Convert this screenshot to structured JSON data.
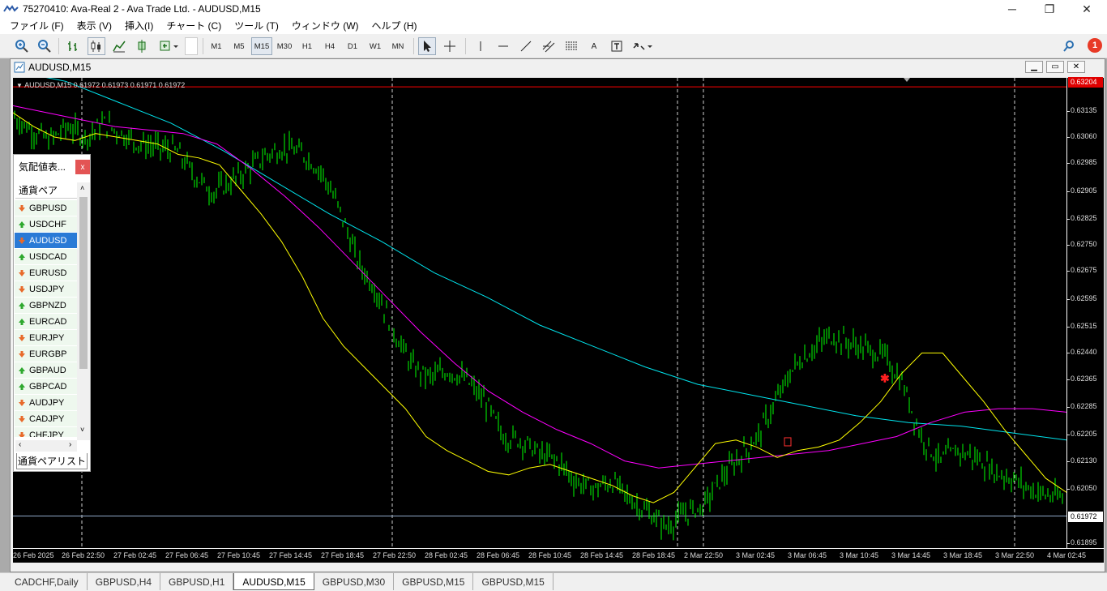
{
  "window": {
    "title": "75270410: Ava-Real 2 - Ava Trade Ltd. - AUDUSD,M15",
    "minimize": "─",
    "restore": "❐",
    "close": "✕"
  },
  "menu": [
    "ファイル (F)",
    "表示 (V)",
    "挿入(I)",
    "チャート (C)",
    "ツール (T)",
    "ウィンドウ (W)",
    "ヘルプ (H)"
  ],
  "toolbar": {
    "timeframes": [
      "M1",
      "M5",
      "M15",
      "M30",
      "H1",
      "H4",
      "D1",
      "W1",
      "MN"
    ],
    "active_timeframe": "M15",
    "text_tool": "A",
    "notification_count": "1"
  },
  "chart_window": {
    "title": "AUDUSD,M15",
    "header": "AUDUSD,M15  0.61972 0.61973 0.61971 0.61972"
  },
  "chart_data": {
    "type": "line",
    "symbol": "AUDUSD",
    "timeframe": "M15",
    "ohlc": {
      "open": 0.61972,
      "high": 0.61973,
      "low": 0.61971,
      "close": 0.61972
    },
    "price_ticks": [
      "0.63135",
      "0.63060",
      "0.62985",
      "0.62905",
      "0.62825",
      "0.62750",
      "0.62675",
      "0.62595",
      "0.62515",
      "0.62440",
      "0.62365",
      "0.62285",
      "0.62205",
      "0.62130",
      "0.62050",
      "0.61895"
    ],
    "time_ticks": [
      "26 Feb 2025",
      "26 Feb 22:50",
      "27 Feb 02:45",
      "27 Feb 06:45",
      "27 Feb 10:45",
      "27 Feb 14:45",
      "27 Feb 18:45",
      "27 Feb 22:50",
      "28 Feb 02:45",
      "28 Feb 06:45",
      "28 Feb 10:45",
      "28 Feb 14:45",
      "28 Feb 18:45",
      "2 Mar 22:50",
      "3 Mar 02:45",
      "3 Mar 06:45",
      "3 Mar 10:45",
      "3 Mar 14:45",
      "3 Mar 18:45",
      "3 Mar 22:50",
      "4 Mar 02:45"
    ],
    "ylim": [
      0.6188,
      0.6323
    ],
    "high_line_label": "0.63204",
    "current_price_label": "0.61972",
    "colors": {
      "price": "#00ff00",
      "ma_fast": "#ffff00",
      "ma_mid": "#ff00ff",
      "ma_slow": "#00e5ee",
      "high_line": "#ff0000",
      "current_line": "#8fa8c8"
    },
    "series": [
      {
        "role": "price",
        "values": [
          0.6312,
          0.6308,
          0.6305,
          0.6309,
          0.6306,
          0.631,
          0.6307,
          0.6304,
          0.6303,
          0.6302,
          0.6295,
          0.629,
          0.6293,
          0.6297,
          0.6301,
          0.6303,
          0.6301,
          0.6296,
          0.6285,
          0.627,
          0.6262,
          0.625,
          0.624,
          0.6237,
          0.6239,
          0.6236,
          0.623,
          0.622,
          0.6219,
          0.6215,
          0.6213,
          0.6207,
          0.6205,
          0.6207,
          0.6202,
          0.6198,
          0.6194,
          0.6198,
          0.62,
          0.6208,
          0.6214,
          0.622,
          0.623,
          0.624,
          0.6245,
          0.6249,
          0.6247,
          0.6245,
          0.6243,
          0.6235,
          0.622,
          0.6213,
          0.6216,
          0.6214,
          0.621,
          0.6208,
          0.6205,
          0.6203,
          0.6202
        ]
      },
      {
        "role": "ma_fast",
        "values": [
          0.6313,
          0.6309,
          0.6306,
          0.6305,
          0.6307,
          0.6306,
          0.6305,
          0.6304,
          0.6301,
          0.63,
          0.6298,
          0.6291,
          0.6284,
          0.6276,
          0.6266,
          0.6254,
          0.6246,
          0.624,
          0.6234,
          0.6228,
          0.622,
          0.6216,
          0.6213,
          0.621,
          0.6209,
          0.6211,
          0.6212,
          0.621,
          0.6208,
          0.6206,
          0.6203,
          0.6201,
          0.6204,
          0.6211,
          0.6218,
          0.6219,
          0.6217,
          0.6214,
          0.6216,
          0.6217,
          0.6219,
          0.6224,
          0.623,
          0.6238,
          0.6244,
          0.6244,
          0.6237,
          0.623,
          0.6222,
          0.6215,
          0.6208,
          0.6204
        ]
      },
      {
        "role": "ma_mid",
        "values": [
          0.6315,
          0.6313,
          0.6311,
          0.6309,
          0.6308,
          0.6307,
          0.6304,
          0.6297,
          0.6289,
          0.628,
          0.627,
          0.626,
          0.625,
          0.6241,
          0.6233,
          0.6227,
          0.6222,
          0.6218,
          0.6213,
          0.6211,
          0.6212,
          0.6213,
          0.6214,
          0.6215,
          0.6216,
          0.6218,
          0.622,
          0.6224,
          0.6227,
          0.6228,
          0.6228,
          0.6227
        ]
      },
      {
        "role": "ma_slow",
        "values": [
          0.6325,
          0.6322,
          0.6316,
          0.631,
          0.6302,
          0.6293,
          0.6284,
          0.6276,
          0.6267,
          0.626,
          0.6252,
          0.6246,
          0.624,
          0.6235,
          0.6232,
          0.6229,
          0.6226,
          0.6224,
          0.6223,
          0.6221,
          0.6219
        ]
      }
    ]
  },
  "market_watch": {
    "title": "気配値表...",
    "close": "x",
    "column_header": "通貨ペア",
    "tab_label": "通貨ペアリスト",
    "selected": "AUDUSD",
    "symbols": [
      {
        "name": "GBPUSD",
        "dir": "down"
      },
      {
        "name": "USDCHF",
        "dir": "up"
      },
      {
        "name": "AUDUSD",
        "dir": "down"
      },
      {
        "name": "USDCAD",
        "dir": "up"
      },
      {
        "name": "EURUSD",
        "dir": "down"
      },
      {
        "name": "USDJPY",
        "dir": "down"
      },
      {
        "name": "GBPNZD",
        "dir": "up"
      },
      {
        "name": "EURCAD",
        "dir": "up"
      },
      {
        "name": "EURJPY",
        "dir": "down"
      },
      {
        "name": "EURGBP",
        "dir": "down"
      },
      {
        "name": "GBPAUD",
        "dir": "up"
      },
      {
        "name": "GBPCAD",
        "dir": "up"
      },
      {
        "name": "AUDJPY",
        "dir": "down"
      },
      {
        "name": "CADJPY",
        "dir": "down"
      },
      {
        "name": "CHFJPY",
        "dir": "down"
      }
    ]
  },
  "bottom_tabs": [
    "CADCHF,Daily",
    "GBPUSD,H4",
    "GBPUSD,H1",
    "AUDUSD,M15",
    "GBPUSD,M30",
    "GBPUSD,M15",
    "GBPUSD,M15"
  ],
  "active_tab": "AUDUSD,M15"
}
